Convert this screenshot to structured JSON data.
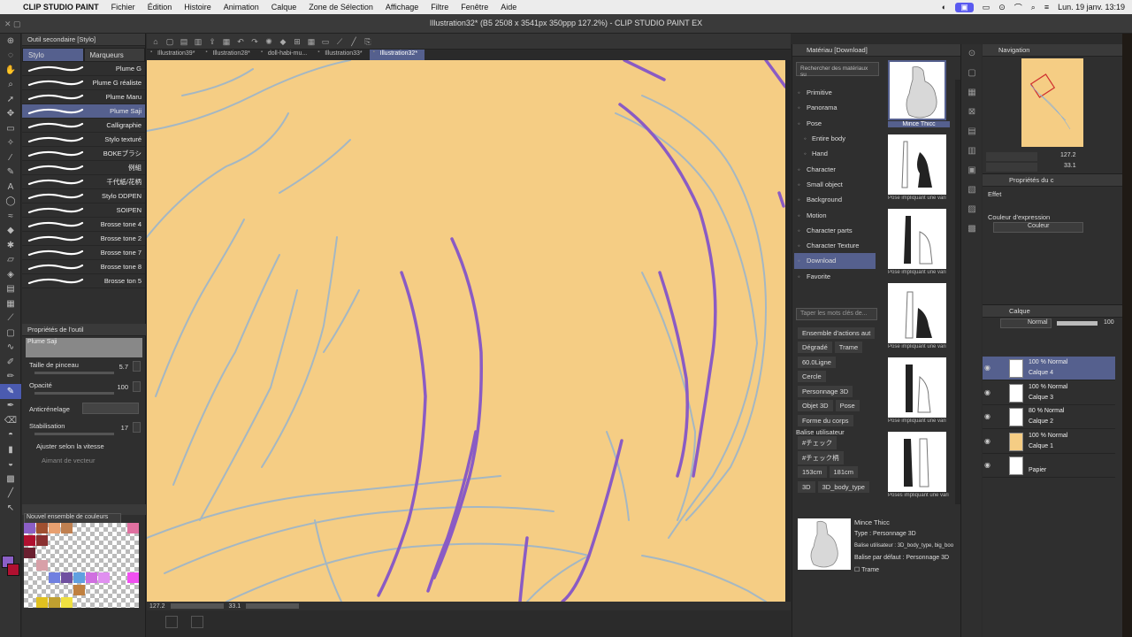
{
  "menubar": {
    "app": "CLIP STUDIO PAINT",
    "menus": [
      "Fichier",
      "Édition",
      "Histoire",
      "Animation",
      "Calque",
      "Zone de Sélection",
      "Affichage",
      "Filtre",
      "Fenêtre",
      "Aide"
    ],
    "clock": "Lun. 19 janv.  13:19"
  },
  "window": {
    "title": "Illustration32* (B5 2508 x 3541px 350ppp 127.2%) - CLIP STUDIO PAINT EX"
  },
  "subtool": {
    "header": "Outil secondaire [Stylo]",
    "tabs": [
      "Stylo",
      "Marqueurs"
    ],
    "brushes": [
      "Plume G",
      "Plume G réaliste",
      "Plume Maru",
      "Plume Saji",
      "Calligraphie",
      "Stylo texturé",
      "BOKEブラシ",
      "例組",
      "千代紙/花柄",
      "Stylo DDPEN",
      "SOIPEN",
      "Brosse tone 4",
      "Brosse tone 2",
      "Brosse tone 7",
      "Brosse tone 8",
      "Brosse ton 5"
    ],
    "active_brush_index": 3
  },
  "tool_props": {
    "header": "Propriétés de l'outil",
    "preview_name": "Plume Saji",
    "brush_size_label": "Taille de pinceau",
    "brush_size_value": "5.7",
    "opacity_label": "Opacité",
    "opacity_value": "100",
    "antialias_label": "Anticrénelage",
    "stabilization_label": "Stabilisation",
    "stabilization_value": "17",
    "speed_label": "Ajuster selon la vitesse",
    "vector_label": "Aimant de vecteur"
  },
  "palette": {
    "title": "Nouvel ensemble de couleurs"
  },
  "doc_tabs": [
    "Illustration39*",
    "Illustration28*",
    "doll-habi-mu...",
    "Illustration33*",
    "Illustration32*"
  ],
  "active_doc_tab": 4,
  "status": {
    "zoom": "127.2",
    "angle": "33.1"
  },
  "material": {
    "header": "Matériau [Download]",
    "search_placeholder": "Rechercher des matériaux su",
    "tree": [
      "Primitive",
      "Panorama",
      "Pose",
      "Entire body",
      "Hand",
      "Character",
      "Small object",
      "Background",
      "Motion",
      "Character parts",
      "Character Texture",
      "Download",
      "Favorite"
    ],
    "tree_sub": [
      3,
      4
    ],
    "tree_active": 11,
    "tag_search_placeholder": "Taper les mots clés de...",
    "tag_rows": [
      [
        "Ensemble d'actions aut"
      ],
      [
        "Dégradé",
        "Trame"
      ],
      [
        "60.0Ligne"
      ],
      [
        "Cercle"
      ],
      [
        "Personnage 3D"
      ],
      [
        "Objet 3D",
        "Pose"
      ],
      [
        "Forme du corps"
      ]
    ],
    "user_tags_title": "Balise utilisateur",
    "user_tag_rows": [
      [
        "#チェック"
      ],
      [
        "#チェック柄"
      ],
      [
        "153cm",
        "181cm"
      ],
      [
        "3D",
        "3D_body_type"
      ]
    ],
    "thumbs": [
      "Mince Thicc",
      "Pose impliquant une vari",
      "Pose impliquant une vari",
      "Pose impliquant une vari",
      "Pose impliquant une vari",
      "Poses impliquant une vari"
    ],
    "info": {
      "name": "Mince Thicc",
      "type": "Type : Personnage 3D",
      "user_tags": "Balise utilisateur : 3D_body_type, big_boo",
      "default_tags": "Balise par défaut : Personnage 3D",
      "checkbox": "Trame"
    }
  },
  "navigator": {
    "title": "Navigation",
    "zoom": "127.2",
    "angle": "33.1"
  },
  "props": {
    "title": "Propriétés du c",
    "effect": "Effet",
    "expression_label": "Couleur d'expression",
    "expression_value": "Couleur"
  },
  "layers": {
    "title": "Calque",
    "blend": "Normal",
    "opacity": "100",
    "items": [
      {
        "mode": "100 % Normal",
        "name": "Calque 4",
        "thumb": "#ffffff"
      },
      {
        "mode": "100 % Normal",
        "name": "Calque 3",
        "thumb": "#ffffff"
      },
      {
        "mode": "80 % Normal",
        "name": "Calque 2",
        "thumb": "#ffffff"
      },
      {
        "mode": "100 % Normal",
        "name": "Calque 1",
        "thumb": "#f5cd84"
      },
      {
        "mode": "",
        "name": "Papier",
        "thumb": "#ffffff"
      }
    ],
    "active_index": 0
  },
  "colors": {
    "canvas": "#f5cd84",
    "accent": "#55608e",
    "stroke_purple": "#8a5bc4",
    "stroke_blue": "#8ab0d8"
  }
}
